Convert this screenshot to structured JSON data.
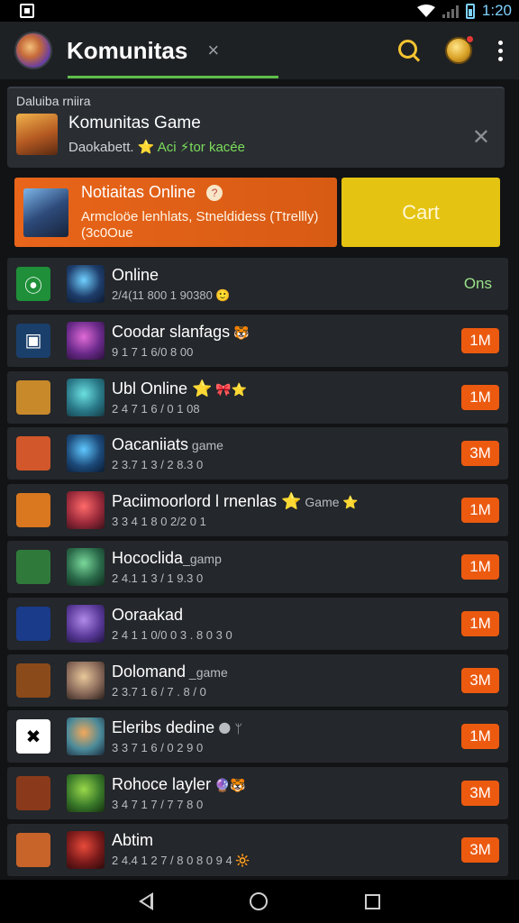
{
  "status_bar": {
    "time": "1:20"
  },
  "app_bar": {
    "title": "Komunitas",
    "close_glyph": "×"
  },
  "featured": {
    "header": "Daluiba rniira",
    "title": "Komunitas Game",
    "subtitle_prefix": "Daokabett. ⭐",
    "subtitle_highlight": "Aci ⚡tor kacée",
    "close_glyph": "✕"
  },
  "promo": {
    "title": "Notiaitas Online",
    "badge": "?",
    "desc_line1": "Armcloöe lenhlats, Stneldidess (Ttrellly)",
    "desc_line2": "(3c0Oue"
  },
  "cart_button": {
    "label": "Cart"
  },
  "list": [
    {
      "title": "Online",
      "extra": "",
      "sub": "2/4(11 800 1 90380 🙂",
      "pill": "Ons",
      "pill_style": "green",
      "icon1": {
        "bg": "#1f8f3a",
        "glyph": "⦿"
      },
      "icon2_colors": [
        "#6fd0ff",
        "#1e3d6b",
        "#0d1a2e"
      ]
    },
    {
      "title": "Coodar slanfags",
      "extra": " 🐯",
      "sub": "9 1 7 1 6/0 8 00",
      "pill": "1M",
      "pill_style": "orange",
      "icon1": {
        "bg": "#1a3f6b",
        "glyph": "▣"
      },
      "icon2_colors": [
        "#e06ad6",
        "#6a2a8a",
        "#2a0f3a"
      ]
    },
    {
      "title": "Ubl Online ⭐",
      "extra": " 🎀⭐",
      "sub": "2 4 7 1 6 / 0 1 08",
      "pill": "1M",
      "pill_style": "orange",
      "icon1": {
        "bg": "#c7892a",
        "glyph": ""
      },
      "icon2_colors": [
        "#6be0e0",
        "#2a7a8a",
        "#143a44"
      ]
    },
    {
      "title": "Oacaniiats",
      "extra": " game",
      "sub": "2 3.7 1 3 / 2 8.3 0",
      "pill": "3M",
      "pill_style": "orange",
      "icon1": {
        "bg": "#d2572a",
        "glyph": ""
      },
      "icon2_colors": [
        "#5fc8ff",
        "#1c4a7a",
        "#0a1a30"
      ]
    },
    {
      "title": "Paciimoorlord l rnenlas ⭐",
      "extra": " Game ⭐",
      "sub": "3 3 4 1 8 0 2/2 0 1",
      "pill": "1M",
      "pill_style": "orange",
      "icon1": {
        "bg": "#d9781f",
        "glyph": ""
      },
      "icon2_colors": [
        "#ff6a6a",
        "#9a2a3a",
        "#3a1018"
      ]
    },
    {
      "title": "Hococlida",
      "extra": "_gamp",
      "sub": "2 4.1 1 3 / 1 9.3 0",
      "pill": "1M",
      "pill_style": "orange",
      "icon1": {
        "bg": "#2f7a3a",
        "glyph": ""
      },
      "icon2_colors": [
        "#7ad89a",
        "#2a6a4a",
        "#102a1c"
      ]
    },
    {
      "title": "Ooraakad",
      "extra": "",
      "sub": "2 4 1 1 0/0 0 3 . 8 0 3 0",
      "pill": "1M",
      "pill_style": "orange",
      "icon1": {
        "bg": "#1a3a8a",
        "glyph": ""
      },
      "icon2_colors": [
        "#b08ae8",
        "#5a3a9a",
        "#1f1440"
      ]
    },
    {
      "title": "Dolomand",
      "extra": " _game",
      "sub": "2 3.7 1 6 / 7 . 8 / 0",
      "pill": "3M",
      "pill_style": "orange",
      "icon1": {
        "bg": "#8a4a1a",
        "glyph": ""
      },
      "icon2_colors": [
        "#e8c89a",
        "#8a6a5a",
        "#2a1f1a"
      ]
    },
    {
      "title": "Eleribs dedine",
      "extra": " 🌑 ᛘ",
      "sub": "3 3 7 1 6 / 0 2 9 0",
      "pill": "1M",
      "pill_style": "orange",
      "icon1": {
        "bg": "#ffffff",
        "glyph": "✖"
      },
      "icon2_colors": [
        "#f2a85a",
        "#4a8a9a",
        "#1a2a3a"
      ]
    },
    {
      "title": "Rohoce layler",
      "extra": " 🔮🐯",
      "sub": "3 4 7 1 7 / 7 7 8 0",
      "pill": "3M",
      "pill_style": "orange",
      "icon1": {
        "bg": "#8a3a1a",
        "glyph": ""
      },
      "icon2_colors": [
        "#9ad84a",
        "#3a7a2a",
        "#14300f"
      ]
    },
    {
      "title": "Abtim",
      "extra": "",
      "sub": "2 4.4 1 2 7 / 8 0 8 0 9 4 🔆",
      "pill": "3M",
      "pill_style": "orange",
      "icon1": {
        "bg": "#c8632a",
        "glyph": ""
      },
      "icon2_colors": [
        "#e84a3a",
        "#7a1a1a",
        "#2a0a0a"
      ]
    }
  ]
}
